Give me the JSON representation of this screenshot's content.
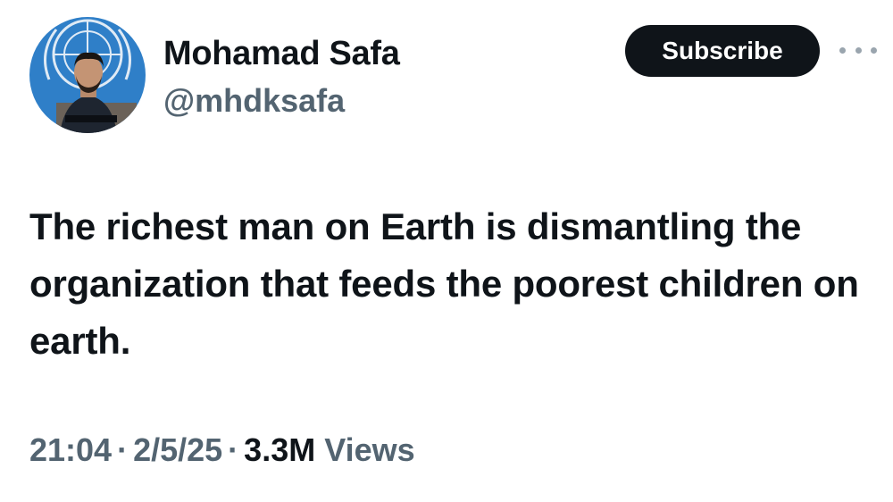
{
  "author": {
    "name": "Mohamad Safa",
    "handle": "@mhdksafa"
  },
  "actions": {
    "subscribe_label": "Subscribe",
    "more_icon": "more-horizontal-icon"
  },
  "tweet": {
    "text": "The richest man on Earth is dismantling the organization that feeds the poorest children on earth.",
    "time": "21:04",
    "date": "2/5/25",
    "separator": "·",
    "views_count": "3.3M",
    "views_label": "Views"
  },
  "colors": {
    "text_primary": "#0f1419",
    "text_secondary": "#536471",
    "button_bg": "#0f1419",
    "avatar_bg": "#2f7fc8"
  }
}
